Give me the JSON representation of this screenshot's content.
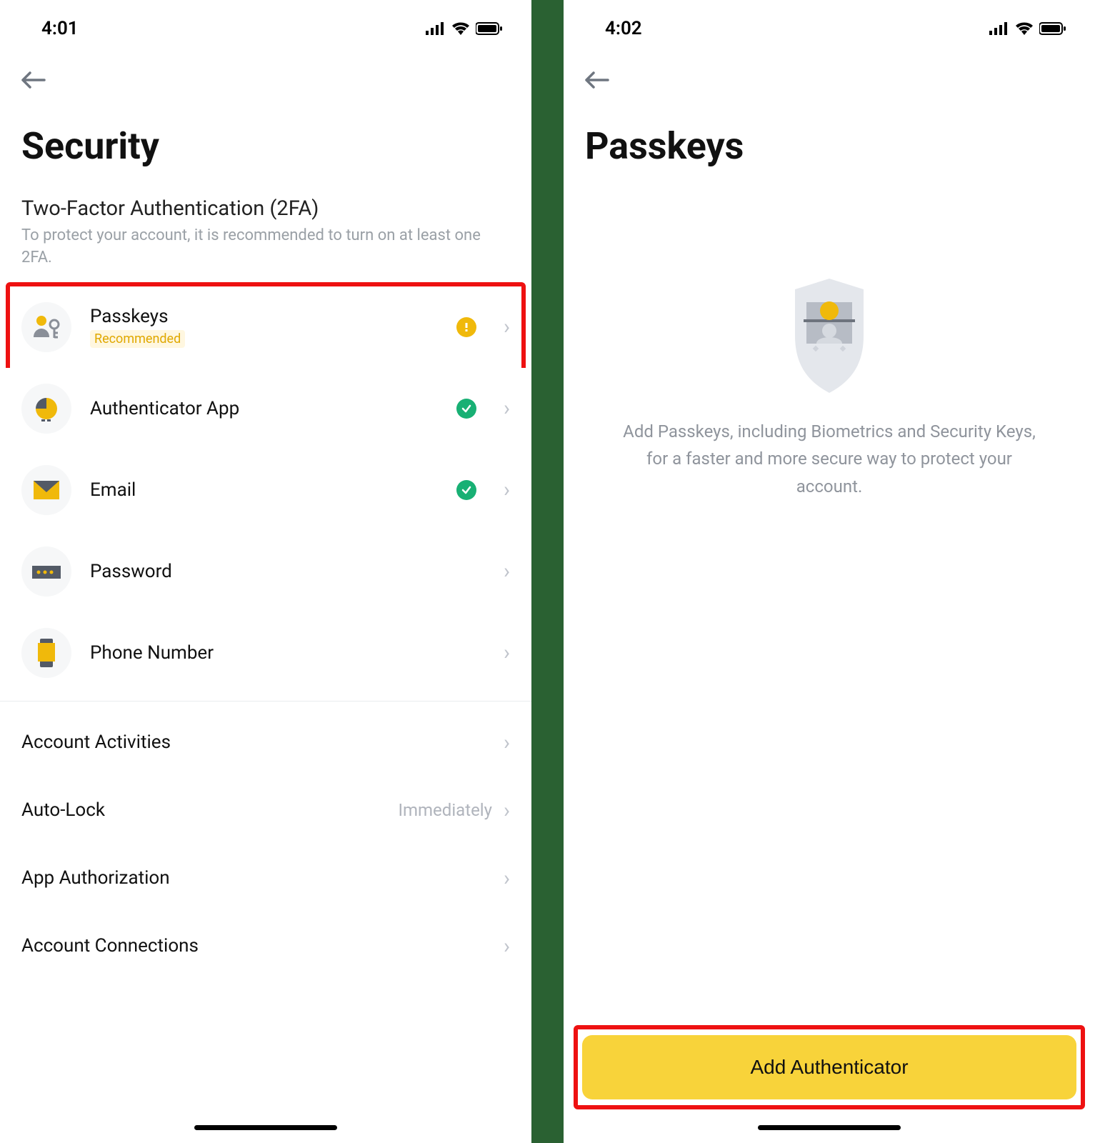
{
  "left": {
    "status_time": "4:01",
    "page_title": "Security",
    "tfa_heading": "Two-Factor Authentication (2FA)",
    "tfa_desc": "To protect your account, it is recommended to turn on at least one 2FA.",
    "items": [
      {
        "title": "Passkeys",
        "badge": "Recommended",
        "status": "warn"
      },
      {
        "title": "Authenticator App",
        "status": "ok"
      },
      {
        "title": "Email",
        "status": "ok"
      },
      {
        "title": "Password",
        "status": "none"
      },
      {
        "title": "Phone Number",
        "status": "none"
      }
    ],
    "settings": [
      {
        "label": "Account Activities",
        "value": ""
      },
      {
        "label": "Auto-Lock",
        "value": "Immediately"
      },
      {
        "label": "App Authorization",
        "value": ""
      },
      {
        "label": "Account Connections",
        "value": ""
      }
    ]
  },
  "right": {
    "status_time": "4:02",
    "page_title": "Passkeys",
    "empty_text": "Add Passkeys, including Biometrics and Security Keys, for a faster and more secure way to protect your account.",
    "button_label": "Add Authenticator"
  }
}
